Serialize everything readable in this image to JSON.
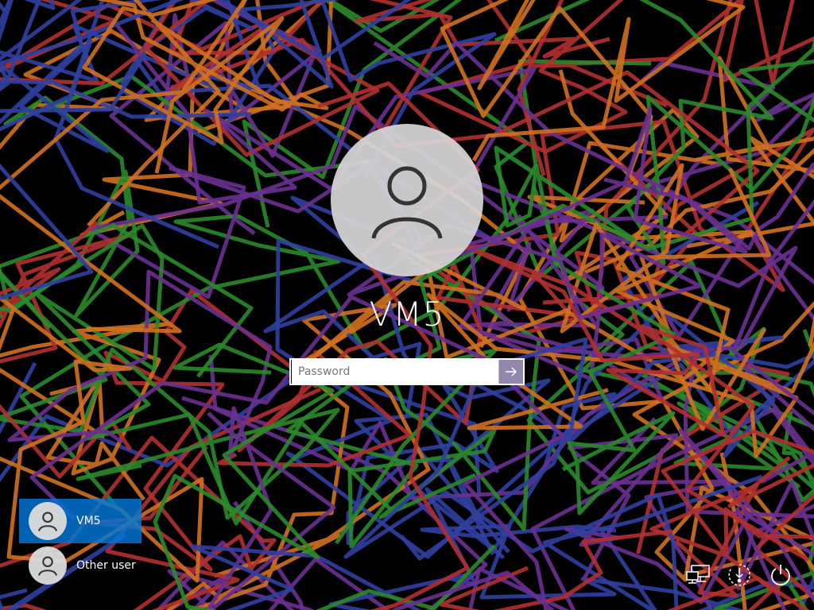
{
  "login": {
    "username": "VM5",
    "password_placeholder": "Password"
  },
  "user_list": [
    {
      "name": "VM5",
      "selected": true
    },
    {
      "name": "Other user",
      "selected": false
    }
  ],
  "tray": {
    "icons": [
      "network-icon",
      "ease-of-access-icon",
      "power-icon"
    ]
  },
  "theme": {
    "wallpaper_colors": [
      "#2a8a2a",
      "#b03030",
      "#d07020",
      "#6a3090",
      "#3040a0"
    ],
    "selected_tile_color": "#0078d7"
  }
}
